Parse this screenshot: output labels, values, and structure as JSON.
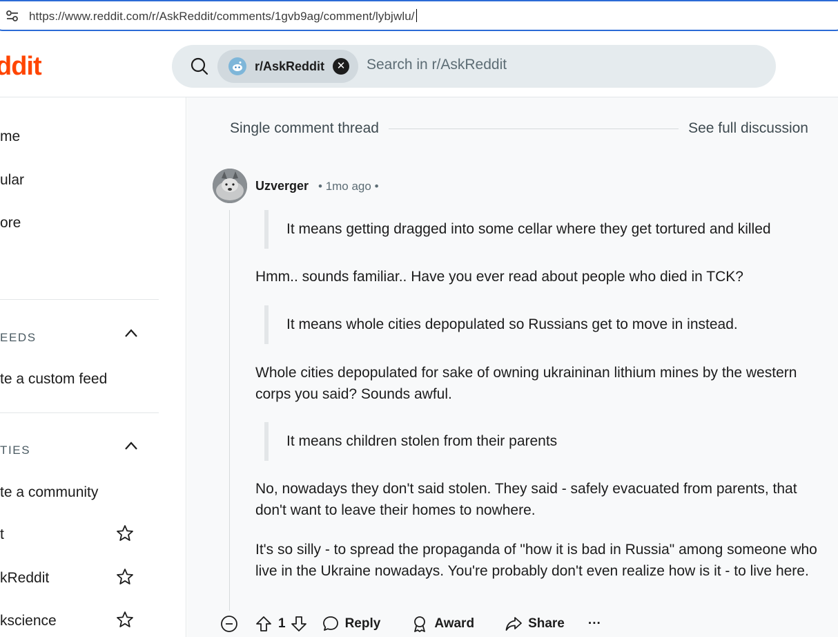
{
  "browser": {
    "url": "https://www.reddit.com/r/AskReddit/comments/1gvb9ag/comment/lybjwlu/"
  },
  "header": {
    "logo_text": "ddit",
    "search_chip": "r/AskReddit",
    "search_placeholder": "Search in r/AskReddit"
  },
  "sidebar": {
    "nav": [
      "me",
      "ular",
      "ore"
    ],
    "feeds_header": "EEDS",
    "create_feed": "te a custom feed",
    "communities_header": "TIES",
    "create_community": "te a community",
    "communities": [
      "t",
      "kReddit",
      "kscience"
    ]
  },
  "thread": {
    "label": "Single comment thread",
    "full_link": "See full discussion"
  },
  "comment": {
    "author": "Uzverger",
    "time": "1mo ago",
    "quote1": "It means getting dragged into some cellar where they get tortured and killed",
    "reply1": "Hmm.. sounds familiar.. Have you ever read about people who died in TCK?",
    "quote2": "It means whole cities depopulated so Russians get to move in instead.",
    "reply2": "Whole cities depopulated for sake of owning ukraininan lithium mines by the western corps you said? Sounds awful.",
    "quote3": "It means children stolen from their parents",
    "reply3": "No, nowadays they don't said stolen. They said - safely evacuated from parents, that don't want to leave their homes to nowhere.",
    "reply4": "It's so silly - to spread the propaganda of \"how it is bad in Russia\" among someone who live in the Ukraine nowadays. You're probably don't even realize how is it - to live here.",
    "score": "1",
    "reply_label": "Reply",
    "award_label": "Award",
    "share_label": "Share",
    "more_label": "···"
  },
  "colors": {
    "brand": "#ff4500",
    "focus": "#2b6bd6"
  }
}
